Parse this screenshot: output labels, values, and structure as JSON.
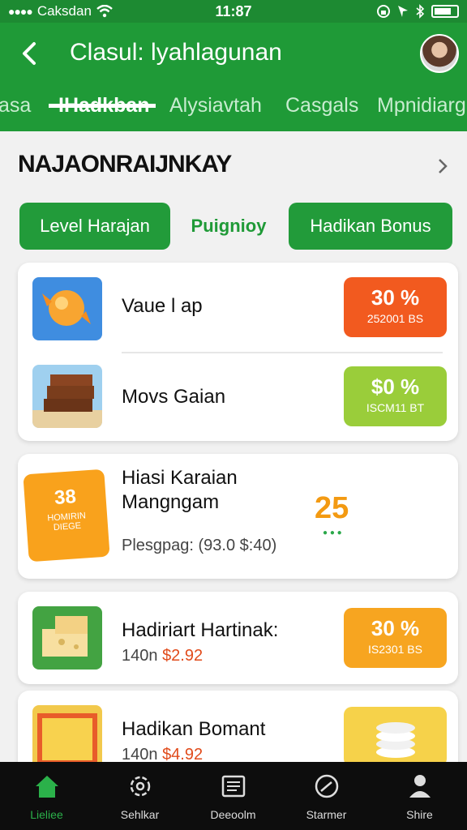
{
  "status_bar": {
    "carrier": "Caksdan",
    "time": "11:87"
  },
  "header": {
    "title": "Clasul: lyahlagunan",
    "tabs": [
      "asa",
      "IHadkban",
      "Alysiavtah",
      "Casgals",
      "Mpnidiarg"
    ],
    "active_tab_index": 1
  },
  "section": {
    "title": "NAJAONRAIJNKAY"
  },
  "chips": [
    "Level Harajan",
    "Puignioy",
    "Hadikan Bonus"
  ],
  "cards": {
    "first": [
      {
        "name": "Vaue l ap",
        "badge_pct": "30 %",
        "badge_code": "252001 BS",
        "badge_color": "#f25a1f"
      },
      {
        "name": "Movs Gaian",
        "badge_pct": "$0 %",
        "badge_code": "ISCM11 BT",
        "badge_color": "#9acd3a"
      }
    ],
    "promo": {
      "name_line1": "Hiasi Karaian",
      "name_line2": "Mangngam",
      "sub": "Plesgpag: (93.0 $:40)",
      "value": "25",
      "tag": "38",
      "tag_sub": "HOMIRIN DIEGE"
    },
    "list": [
      {
        "name": "Hadiriart Hartinak:",
        "qty": "140n",
        "price": "$2.92",
        "badge_pct": "30 %",
        "badge_code": "IS2301 BS",
        "badge_color": "#f7a520"
      },
      {
        "name": "Hadikan Bomant",
        "qty": "140n",
        "price": "$4.92",
        "badge_pct": "",
        "badge_code": "",
        "badge_color": "#f6d24a"
      }
    ]
  },
  "bottom_nav": [
    {
      "label": "Lieliee",
      "icon": "home-icon"
    },
    {
      "label": "Sehlkar",
      "icon": "settings-icon"
    },
    {
      "label": "Deeoolm",
      "icon": "document-icon"
    },
    {
      "label": "Starmer",
      "icon": "clock-icon"
    },
    {
      "label": "Shire",
      "icon": "profile-icon"
    }
  ],
  "colors": {
    "brand_green": "#1f9a37",
    "status_green": "#1d8a32",
    "nav_active": "#2bb14a"
  }
}
